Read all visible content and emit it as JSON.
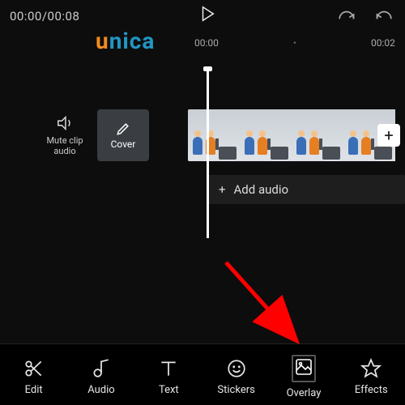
{
  "topbar": {
    "timecode": "00:00/00:08"
  },
  "watermark": {
    "u": "u",
    "rest": "nica"
  },
  "ruler": {
    "t0": "00:00",
    "t1": "00:02"
  },
  "sidebar": {
    "mute_label": "Mute clip audio",
    "cover_label": "Cover"
  },
  "audio": {
    "add_label": "Add audio",
    "plus": "+"
  },
  "plus_clip": "+",
  "tabs": {
    "edit": "Edit",
    "audio": "Audio",
    "text": "Text",
    "stickers": "Stickers",
    "overlay": "Overlay",
    "effects": "Effects"
  }
}
